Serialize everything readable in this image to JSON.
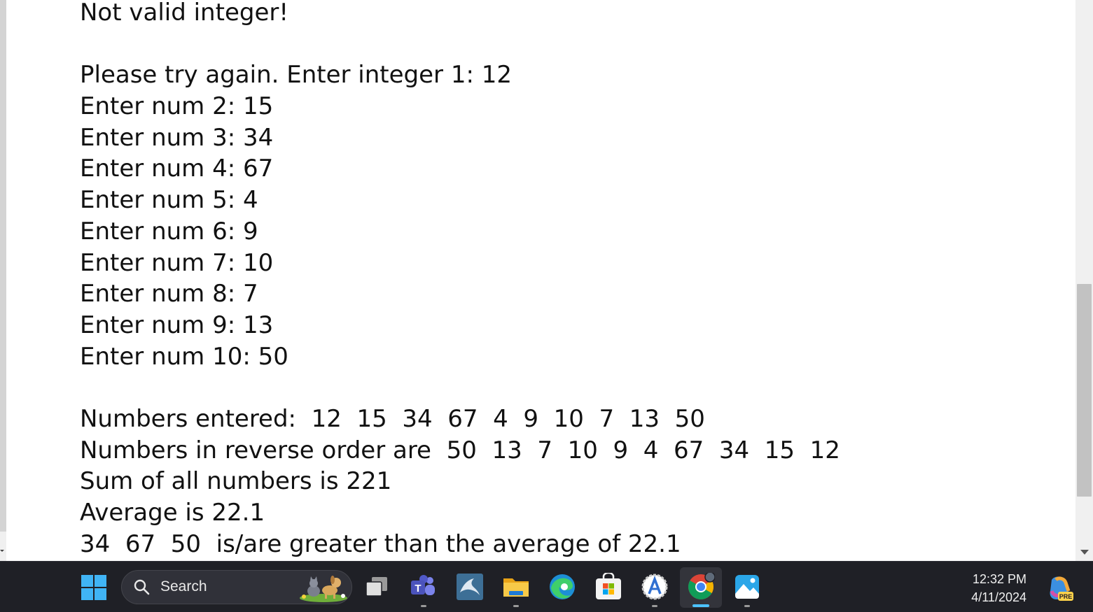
{
  "console": {
    "lines": [
      "Not valid integer!",
      "",
      "Please try again. Enter integer 1: 12",
      "Enter num 2: 15",
      "Enter num 3: 34",
      "Enter num 4: 67",
      "Enter num 5: 4",
      "Enter num 6: 9",
      "Enter num 7: 10",
      "Enter num 8: 7",
      "Enter num 9: 13",
      "Enter num 10: 50",
      "",
      "Numbers entered:  12  15  34  67  4  9  10  7  13  50",
      "Numbers in reverse order are  50  13  7  10  9  4  67  34  15  12",
      "Sum of all numbers is 221",
      "Average is 22.1",
      "34  67  50  is/are greater than the average of 22.1"
    ]
  },
  "scrollbar": {
    "position_fraction": 0.58
  },
  "taskbar": {
    "search_placeholder": "Search",
    "apps": [
      "windows-start",
      "task-view",
      "teams",
      "mysql-workbench",
      "file-explorer",
      "edge",
      "microsoft-store",
      "visual-studio-installer",
      "chrome",
      "photos"
    ],
    "clock_time": "12:32 PM",
    "clock_date": "4/11/2024",
    "copilot_badge": "PRE",
    "accent_color": "#4cc2ff"
  }
}
